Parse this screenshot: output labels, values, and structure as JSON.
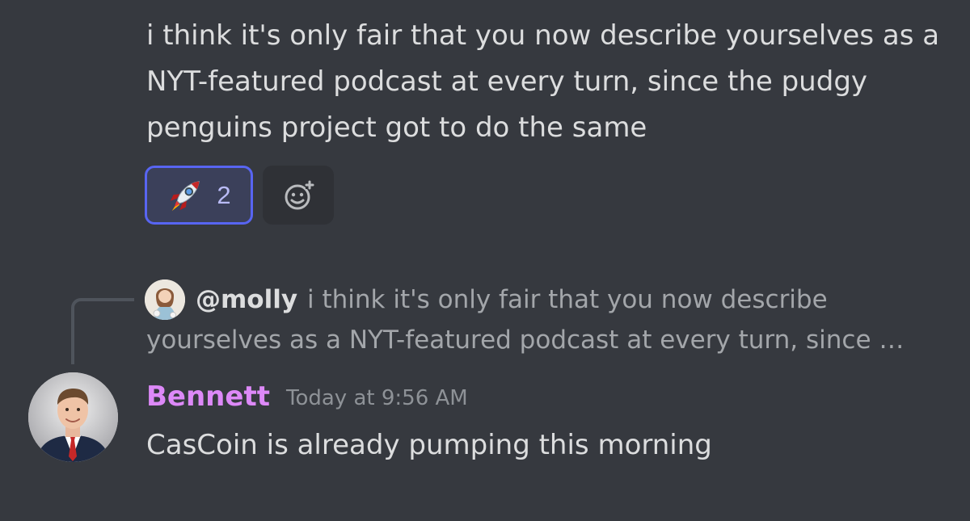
{
  "first_message": {
    "text": "i think it's only fair that you now describe yourselves as a NYT-featured podcast at every turn, since the pudgy penguins project got to do the same",
    "reactions": [
      {
        "emoji_icon": "rocket-icon",
        "count": "2",
        "selected": true
      }
    ],
    "add_reaction_icon": "smile-plus-icon"
  },
  "reply": {
    "author": "@molly",
    "preview": "i think it's only fair that you now describe yourselves as a NYT-featured podcast at every turn, since …"
  },
  "second_message": {
    "author": "Bennett",
    "timestamp": "Today at 9:56 AM",
    "text": "CasCoin is already pumping this morning"
  },
  "colors": {
    "background": "#36393f",
    "text": "#dcddde",
    "accent": "#5865f2",
    "author_color": "#dd89f8",
    "muted": "#a3a6aa"
  }
}
